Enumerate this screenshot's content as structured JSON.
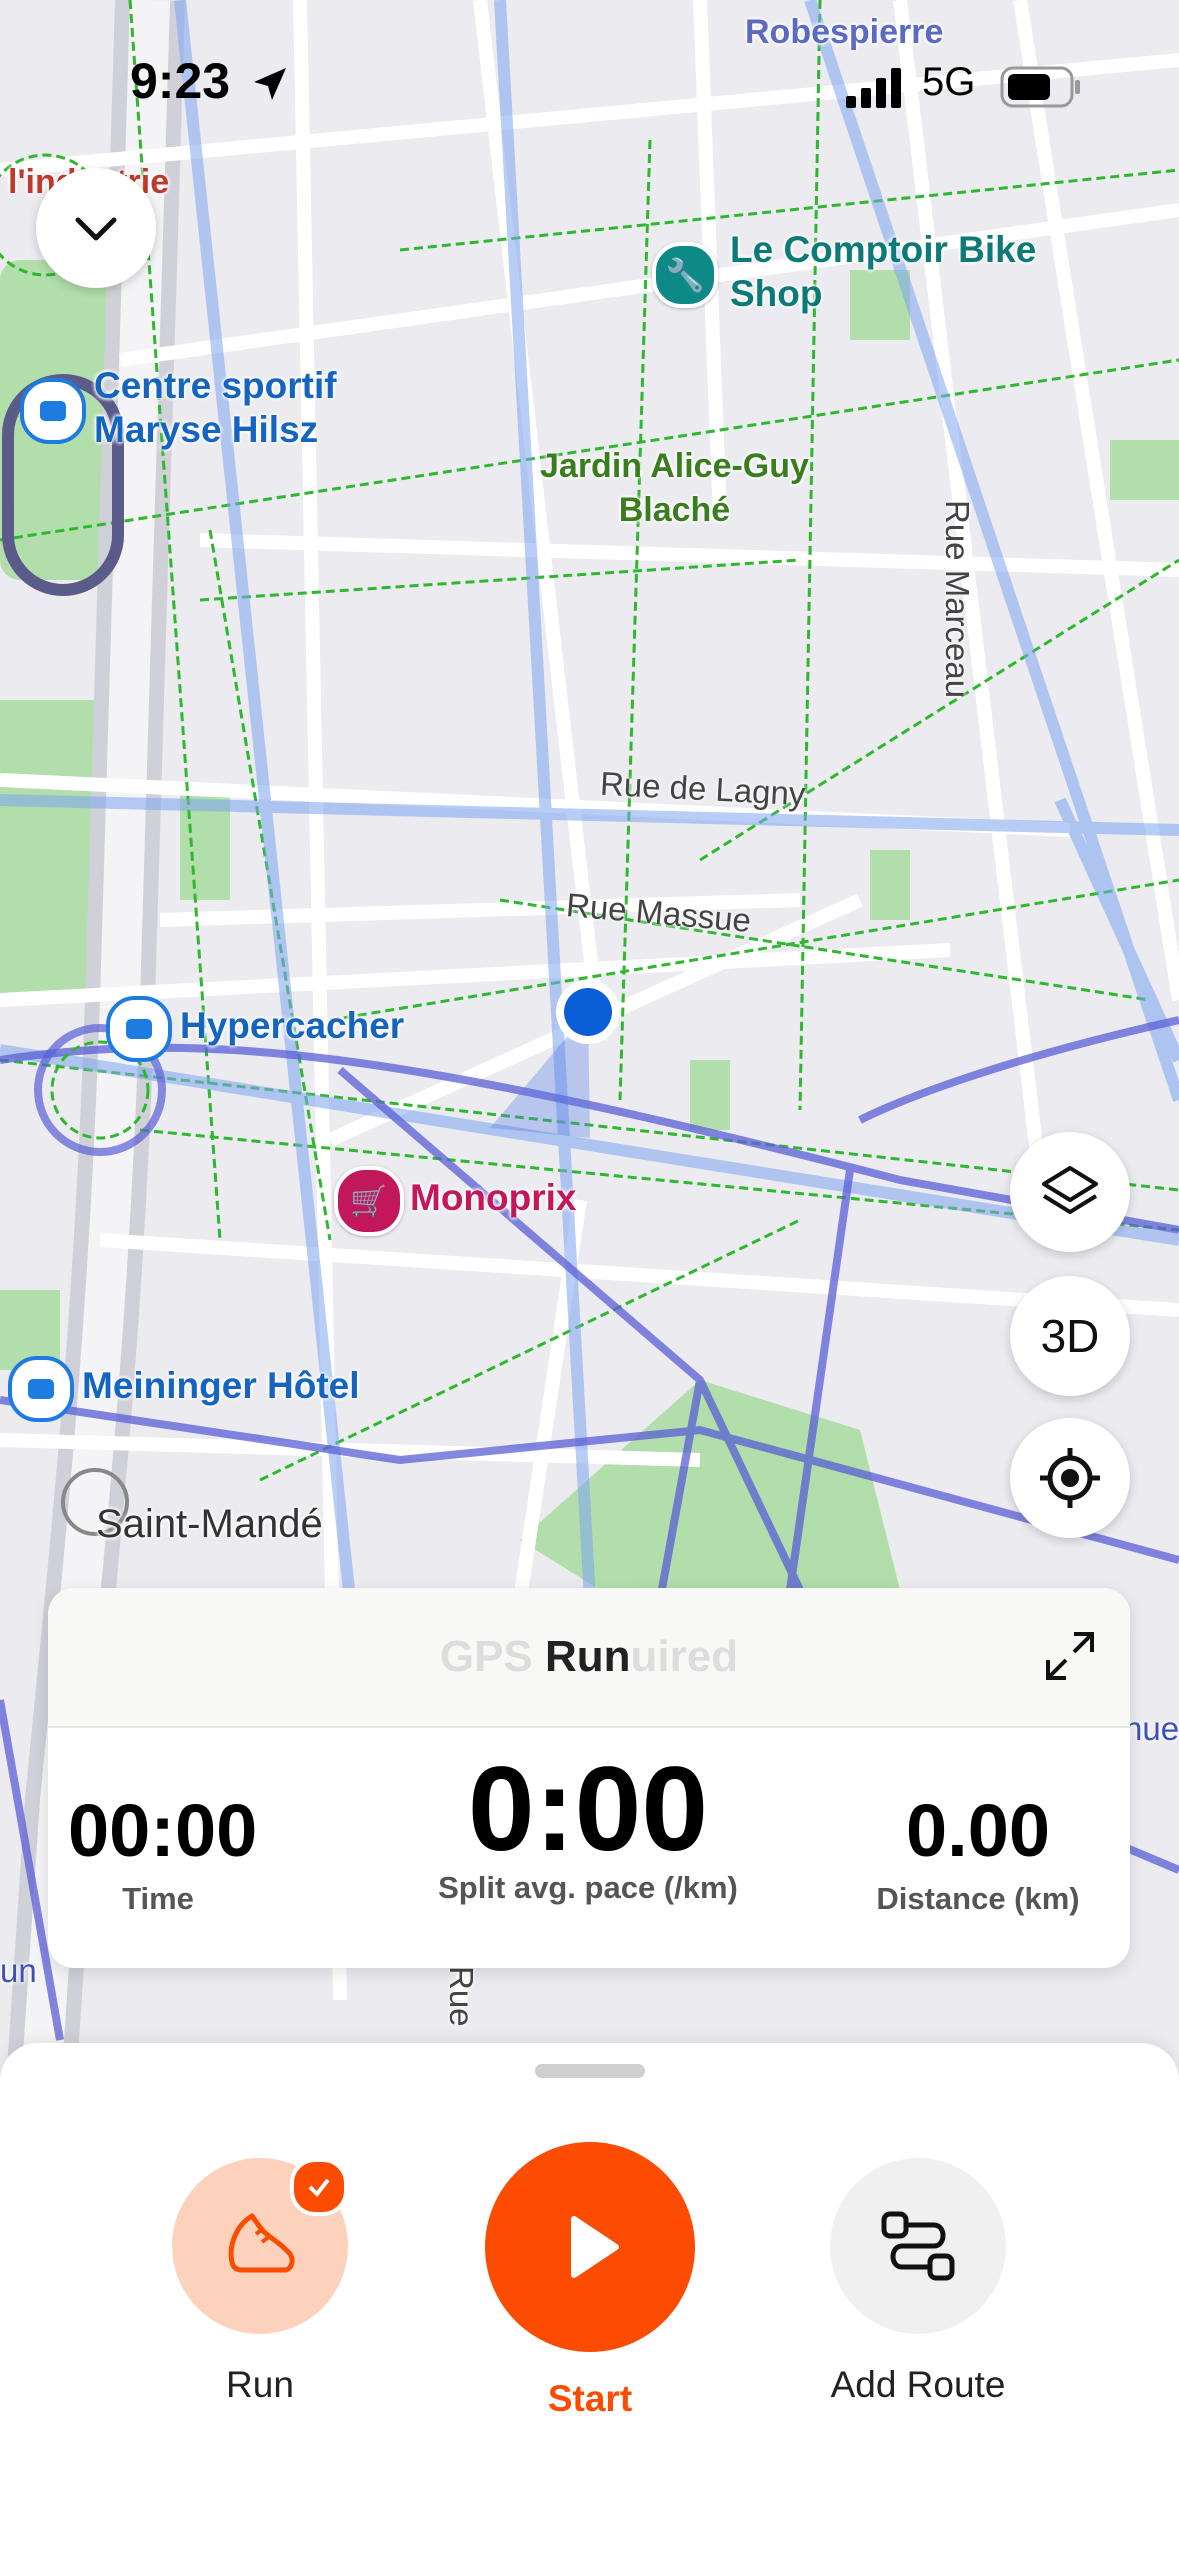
{
  "status_bar": {
    "time": "9:23",
    "network": "5G"
  },
  "map": {
    "pois": {
      "top_left_partial": "l'industrie",
      "bike_shop_line1": "Le Comptoir Bike",
      "bike_shop_line2": "Shop",
      "sport_centre_line1": "Centre sportif",
      "sport_centre_line2": "Maryse Hilsz",
      "park_line1": "Jardin Alice-Guy",
      "park_line2": "Blaché",
      "hypercacher": "Hypercacher",
      "monoprix": "Monoprix",
      "hotel": "Meininger Hôtel",
      "metro_stop": "Saint-Mandé",
      "top_label": "Robespierre"
    },
    "streets": {
      "lagny": "Rue de Lagny",
      "massue": "Rue Massue",
      "marceau": "Rue Marceau",
      "bottom_partial_left": "un",
      "bottom_partial_right": "nue",
      "bottom_partial_rue": "Rue"
    },
    "controls": {
      "three_d_label": "3D"
    }
  },
  "activity_card": {
    "title": "GPS Run",
    "title_ghost_left": "GPS",
    "title_bold": "Run",
    "title_ghost_right": "uired",
    "metrics": [
      {
        "value": "00:00",
        "label": "Time"
      },
      {
        "value": "0:00",
        "label": "Split avg. pace (/km)"
      },
      {
        "value": "0.00",
        "label": "Distance (km)"
      }
    ]
  },
  "bottom_bar": {
    "sport_label": "Run",
    "start_label": "Start",
    "route_label": "Add Route"
  },
  "colors": {
    "accent": "#fc4c02",
    "accent_light": "#fdd2bd",
    "location_blue": "#0b5fd6",
    "poi_blue": "#1565c0",
    "path_green": "#2eb82e",
    "heatmap_purple": "#5a5fd6"
  }
}
